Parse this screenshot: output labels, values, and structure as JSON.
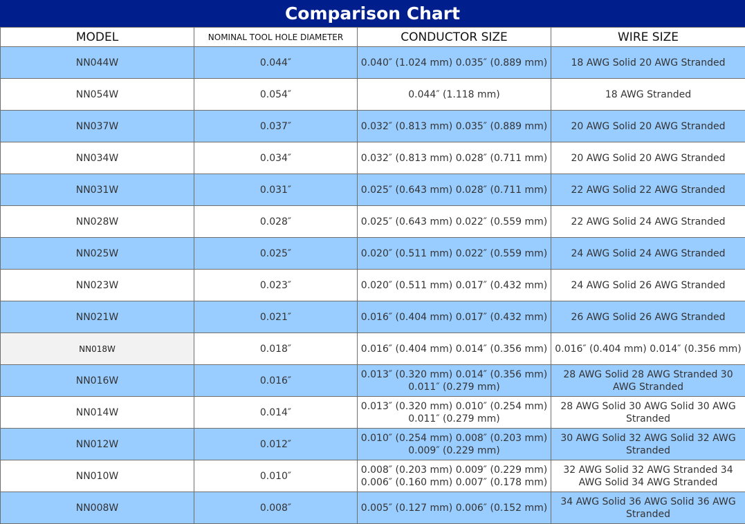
{
  "title": "Comparison Chart",
  "headers": {
    "model": "MODEL",
    "hole": "NOMINAL TOOL HOLE DIAMETER",
    "conductor": "CONDUCTOR SIZE",
    "wire": "WIRE SIZE"
  },
  "rows": [
    {
      "model": "NN044W",
      "hole": "0.044″",
      "conductor": "0.040″ (1.024 mm) 0.035″ (0.889 mm)",
      "wire": "18 AWG Solid 20 AWG Stranded"
    },
    {
      "model": "NN054W",
      "hole": "0.054″",
      "conductor": "0.044″ (1.118 mm)",
      "wire": "18 AWG Stranded"
    },
    {
      "model": "NN037W",
      "hole": "0.037″",
      "conductor": "0.032″ (0.813 mm) 0.035″ (0.889 mm)",
      "wire": "20 AWG Solid 20 AWG Stranded"
    },
    {
      "model": "NN034W",
      "hole": "0.034″",
      "conductor": "0.032″ (0.813 mm) 0.028″ (0.711 mm)",
      "wire": "20 AWG Solid 20 AWG Stranded"
    },
    {
      "model": "NN031W",
      "hole": "0.031″",
      "conductor": "0.025″ (0.643 mm) 0.028″ (0.711 mm)",
      "wire": "22 AWG Solid 22 AWG Stranded"
    },
    {
      "model": "NN028W",
      "hole": "0.028″",
      "conductor": "0.025″ (0.643 mm) 0.022″ (0.559 mm)",
      "wire": "22 AWG Solid 24 AWG Stranded"
    },
    {
      "model": "NN025W",
      "hole": "0.025″",
      "conductor": "0.020″ (0.511 mm) 0.022″ (0.559 mm)",
      "wire": "24 AWG Solid 24 AWG Stranded"
    },
    {
      "model": "NN023W",
      "hole": "0.023″",
      "conductor": "0.020″ (0.511 mm) 0.017″ (0.432 mm)",
      "wire": "24 AWG Solid 26 AWG Stranded"
    },
    {
      "model": "NN021W",
      "hole": "0.021″",
      "conductor": "0.016″ (0.404 mm) 0.017″ (0.432 mm)",
      "wire": "26 AWG Solid 26 AWG Stranded"
    },
    {
      "model": "NN018W",
      "hole": "0.018″",
      "conductor": "0.016″ (0.404 mm) 0.014″ (0.356 mm)",
      "wire": "0.016″ (0.404 mm) 0.014″ (0.356 mm)"
    },
    {
      "model": "NN016W",
      "hole": "0.016″",
      "conductor": "0.013″ (0.320 mm) 0.014″ (0.356 mm) 0.011″ (0.279 mm)",
      "wire": "28 AWG Solid 28 AWG Stranded 30 AWG Stranded"
    },
    {
      "model": "NN014W",
      "hole": "0.014″",
      "conductor": "0.013″ (0.320 mm) 0.010″ (0.254 mm) 0.011″ (0.279 mm)",
      "wire": "28 AWG Solid 30 AWG Solid 30 AWG Stranded"
    },
    {
      "model": "NN012W",
      "hole": "0.012″",
      "conductor": "0.010″ (0.254 mm) 0.008″ (0.203 mm) 0.009″ (0.229 mm)",
      "wire": "30 AWG Solid 32 AWG Solid 32 AWG Stranded"
    },
    {
      "model": "NN010W",
      "hole": "0.010″",
      "conductor": "0.008″ (0.203 mm) 0.009″ (0.229 mm) 0.006″ (0.160 mm) 0.007″ (0.178 mm)",
      "wire": "32 AWG Solid 32 AWG Stranded 34 AWG Solid 34 AWG Stranded"
    },
    {
      "model": "NN008W",
      "hole": "0.008″",
      "conductor": "0.005″ (0.127 mm) 0.006″ (0.152 mm)",
      "wire": "34 AWG Solid 36 AWG Solid 36 AWG Stranded"
    }
  ]
}
